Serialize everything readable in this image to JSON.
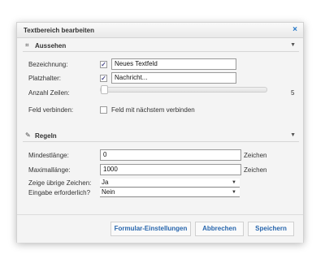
{
  "dialog": {
    "title": "Textbereich bearbeiten",
    "close_glyph": "×"
  },
  "section_appearance": {
    "icon_glyph": "⌗",
    "title": "Aussehen",
    "caret": "▼",
    "name_label": "Bezeichnung:",
    "name_checked": true,
    "name_value": "Neues Textfeld",
    "placeholder_label": "Platzhalter:",
    "placeholder_checked": true,
    "placeholder_value": "Nachricht...",
    "rows_label": "Anzahl Zeilen:",
    "rows_value": "5",
    "rows_slider_fraction": 0.0,
    "connect_label": "Feld verbinden:",
    "connect_checked": false,
    "connect_text": "Feld mit nächstem verbinden"
  },
  "section_rules": {
    "icon_glyph": "✎",
    "title": "Regeln",
    "caret": "▼",
    "min_label": "Mindestlänge:",
    "min_value": "0",
    "min_unit": "Zeichen",
    "max_label": "Maximallänge:",
    "max_value": "1000",
    "max_unit": "Zeichen",
    "remaining_label": "Zeige übrige Zeichen:",
    "remaining_value": "Ja",
    "required_label": "Eingabe erforderlich?",
    "required_value": "Nein",
    "select_arrow": "▼"
  },
  "footer": {
    "settings_button": "Formular-Einstellungen",
    "cancel_button": "Abbrechen",
    "save_button": "Speichern"
  },
  "colors": {
    "accent": "#2866ad",
    "close": "#2477c7"
  }
}
